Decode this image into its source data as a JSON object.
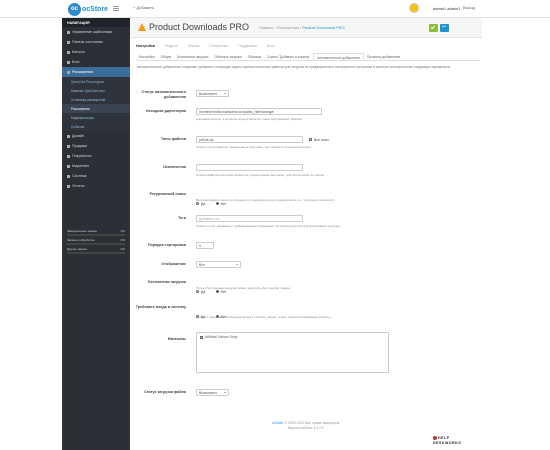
{
  "topbar": {
    "logo_text": "ocStore",
    "add_label": "+ Добавить",
    "user_name": "admin1 admin1",
    "logout_label": "Выход"
  },
  "sidebar": {
    "nav_title": "НАВИГАЦИЯ",
    "items": [
      "Управление шаблонами",
      "Панель состояния",
      "Каталог",
      "Блог",
      "Расширения"
    ],
    "subitems": [
      "OpenCart Pro ресурсы",
      "Магазин OpenCart.com",
      "Установка расширений",
      "Расширения",
      "Модификаторы",
      "События"
    ],
    "items2": [
      "Дизайн",
      "Продажи",
      "Покупатели",
      "Маркетинг",
      "Система",
      "Отчеты"
    ],
    "stats": [
      {
        "label": "Завершенные заказы",
        "value": "0%",
        "fill": 0
      },
      {
        "label": "Заказы в обработке",
        "value": "0%",
        "fill": 0
      },
      {
        "label": "Другие заказы",
        "value": "0%",
        "fill": 0
      }
    ]
  },
  "header": {
    "title": "Product Downloads PRO",
    "breadcrumb_home": "Главная",
    "breadcrumb_sep1": "›",
    "breadcrumb_ext": "Расширения",
    "breadcrumb_sep2": "›",
    "breadcrumb_current": "Product Downloads PRO"
  },
  "tabs_main": [
    "Настройки",
    "Модуль",
    "Значок",
    "Статистика",
    "Поддержка",
    "Блок"
  ],
  "tabs_sub": [
    "Настройки",
    "Общие",
    "Бесплатные загрузки",
    "Обычные загрузки",
    "Образцы",
    "Скрыть \"Добавить в корзину\"",
    "Автоматическое добавление",
    "Просмотр добавления"
  ],
  "description": "Автоматическое добавление открывает добавить с помощью одного щелчка несколько файлов для загрузки из предварительно настроенного источника в каталоге или каталогам следующих параметров.",
  "form": {
    "autoadd_status": {
      "label": "Статус автоматического добавления",
      "value": "Выключено"
    },
    "source_dir": {
      "label": "Исходная директория",
      "value": "/home/ml/ml/domains/test.loc/public_html/storage/",
      "help": "Корневой каталог, в котором осуществляется поиск загружаемых файлов."
    },
    "file_types": {
      "label": "Типы файлов",
      "value": "pdf,txt,zip",
      "all_label": "Все типы",
      "help": "Список типов файлов, разделенных запятыми, для поиска в исходном каталоге."
    },
    "exclusions": {
      "label": "Исключения",
      "value": "",
      "help": "Список файлов или папок каталогов, разделенные запятыми, для исключения из поиска."
    },
    "recursive": {
      "label": "Рекурсивный поиск",
      "yes": "Да",
      "no": "Нет",
      "help": "Включая файлы папок из исходного и подкаталогов его подкаталогов (т.е. \"исходного каталога\")."
    },
    "tags": {
      "label": "Теги",
      "placeholder": "Добавить тег",
      "help": "Список тегов, связанных с добавляемыми загрузками. Теги используются для фильтрации загрузок."
    },
    "sort_order": {
      "label": "Порядок сортировки",
      "value": "0"
    },
    "display": {
      "label": "Отображение",
      "value": "Все"
    },
    "free_download": {
      "label": "Бесплатная загрузка",
      "yes": "Да",
      "no": "Нет",
      "help": "Только бесплатные загрузки можно загрузить без покупки товара."
    },
    "login_required": {
      "label": "Требовать входа в систему",
      "yes": "Да",
      "no": "Нет",
      "help": "Доступ к загрузкам, требующим входа в систему, имеют только зарегистрированные клиенты."
    },
    "stores": {
      "label": "Магазины",
      "item": "Artificial Visions Shop"
    },
    "download_status": {
      "label": "Статус загрузки файла",
      "value": "Выключено"
    }
  },
  "footer": {
    "link": "ocStore",
    "line1_rest": " © 2009-2022 Все права защищены.",
    "line2": "Версия ocStore 3.0.2.0"
  },
  "watermark": {
    "line1": "HELP",
    "line2": "DESKWORKS"
  }
}
